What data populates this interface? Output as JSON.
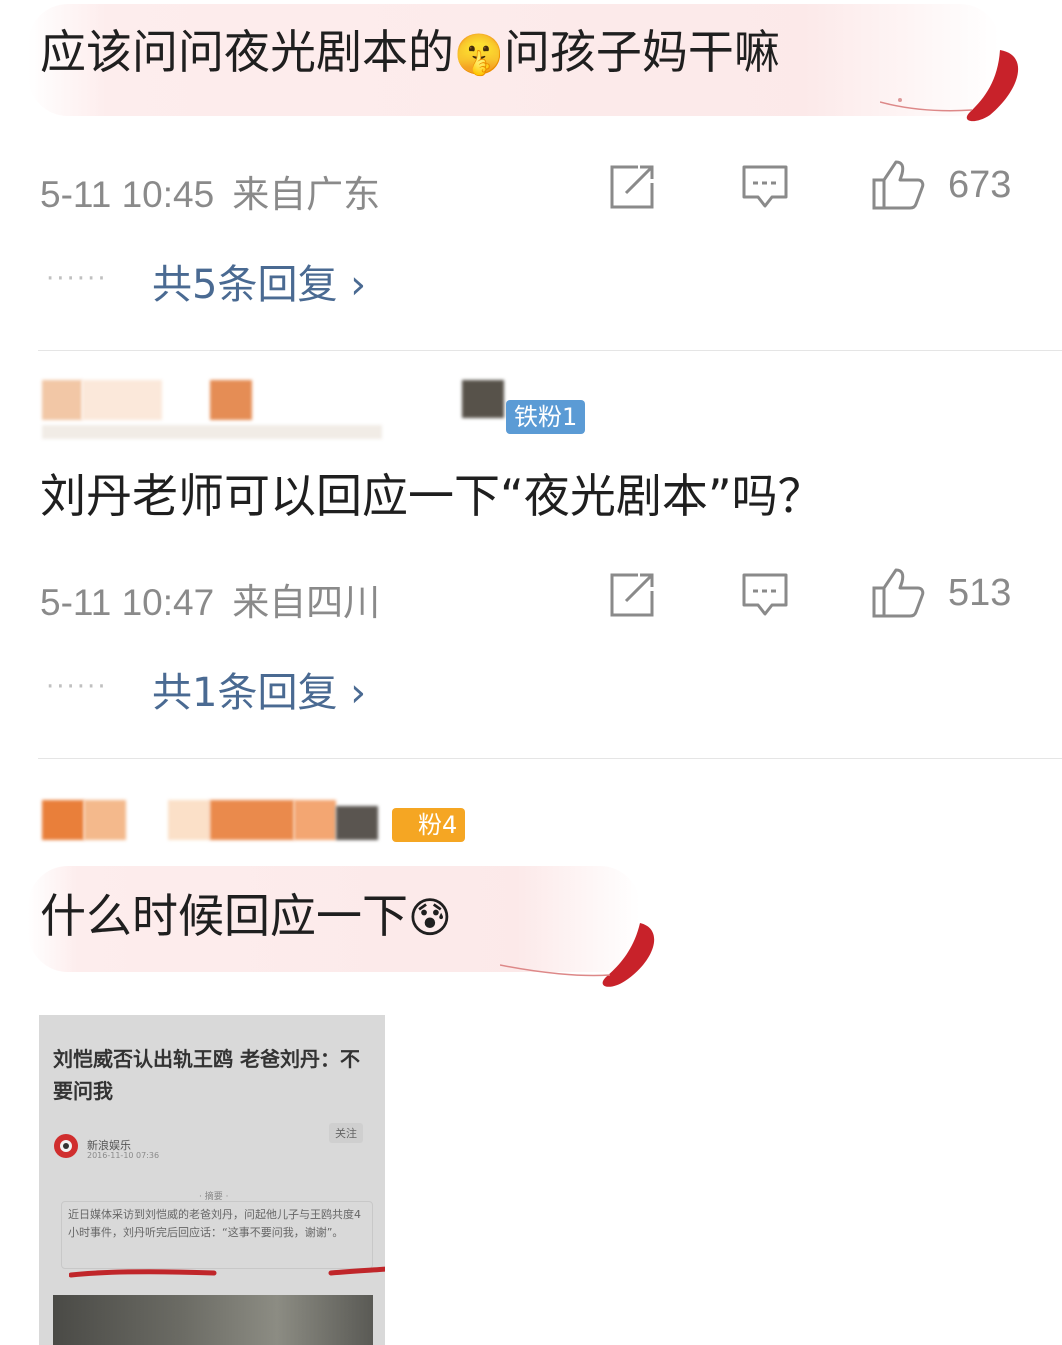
{
  "comments": [
    {
      "text_a": "应该问问夜光剧本的",
      "emoji": "🤫",
      "text_b": "问孩子妈干嘛",
      "time": "5-11 10:45",
      "location": "来自广东",
      "likes": "673",
      "replies": "共5条回复 ›"
    },
    {
      "fan_badge": "铁粉1",
      "text": "刘丹老师可以回应一下“夜光剧本”吗？",
      "time": "5-11 10:47",
      "location": "来自四川",
      "likes": "513",
      "replies": "共1条回复 ›"
    },
    {
      "fan_badge": "粉4",
      "text": "什么时候回应一下",
      "emoji": "😰"
    }
  ],
  "dots": "······",
  "news_card": {
    "title": "刘恺威否认出轨王鸥 老爸刘丹：不要问我",
    "source": "新浪娱乐",
    "date": "2016-11-10 07:36",
    "follow": "关注",
    "summary_head": "· 摘要 ·",
    "summary": "近日媒体采访到刘恺威的老爸刘丹，问起他儿子与王鸥共度4小时事件，刘丹听完后回应话：“这事不要问我，谢谢”。"
  },
  "colors": {
    "reply_link": "#4a6a92",
    "meta_gray": "#8a8a8a",
    "fan_badge_blue": "#5b9bd5",
    "fan_badge_orange": "#f5a623"
  },
  "icons": [
    "share-icon",
    "comment-icon",
    "like-icon",
    "decorative-feather"
  ]
}
